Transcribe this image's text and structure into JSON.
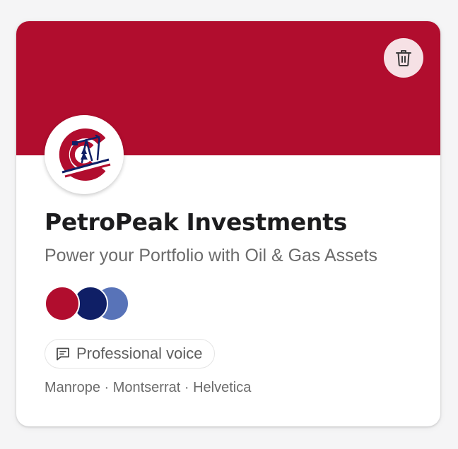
{
  "brand": {
    "name": "PetroPeak Investments",
    "tagline": "Power your Portfolio with Oil & Gas Assets"
  },
  "colors": {
    "banner": "#b10d2e",
    "palette": [
      "#b10d2e",
      "#0f1f66",
      "#5873b8"
    ]
  },
  "voice": {
    "icon": "message-icon",
    "label": "Professional voice"
  },
  "fonts_line": "Manrope · Montserrat · Helvetica",
  "actions": {
    "delete_icon": "trash-icon"
  }
}
